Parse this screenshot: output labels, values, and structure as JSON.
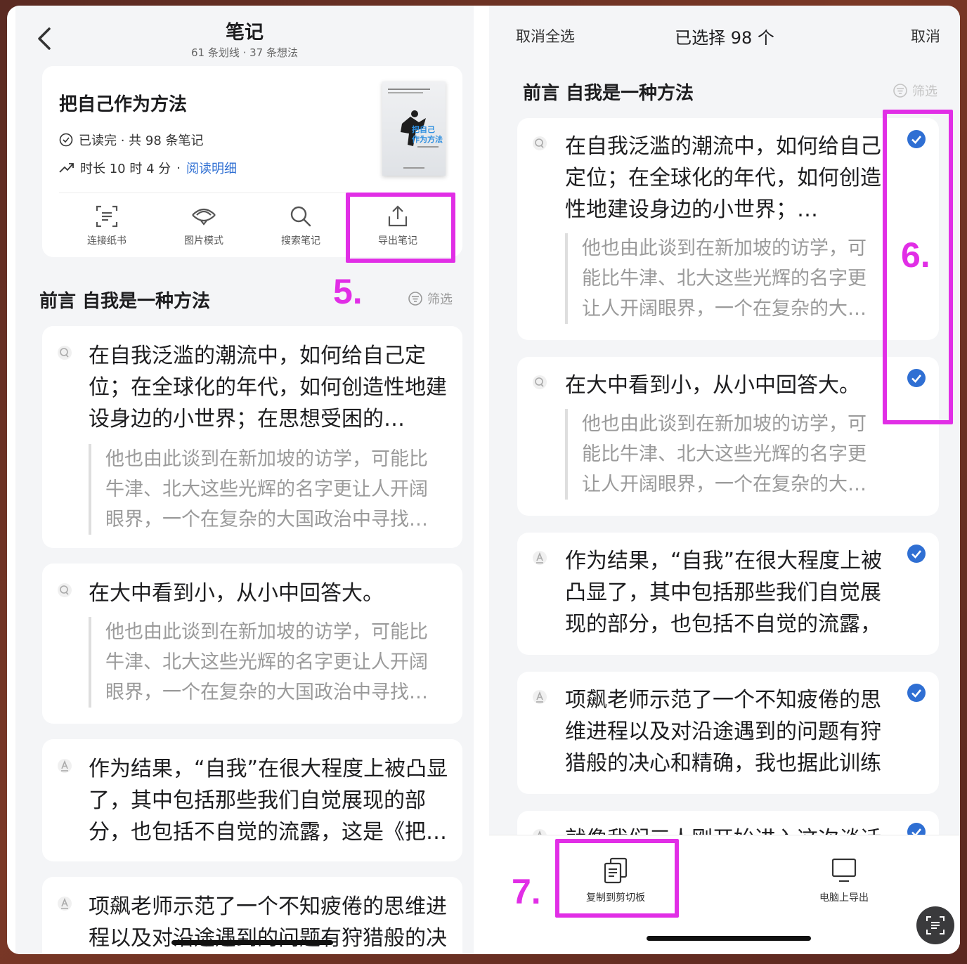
{
  "left": {
    "header": {
      "title": "笔记",
      "subtitle": "61 条划线 · 37 条想法"
    },
    "book": {
      "title": "把自己作为方法",
      "status": "已读完 · 共 98 条笔记",
      "duration": "时长 10 时 4 分",
      "sep": "·",
      "link": "阅读明细",
      "cover_title": "把自己作为方法"
    },
    "tools": [
      {
        "label": "连接纸书",
        "icon": "scan-icon"
      },
      {
        "label": "图片模式",
        "icon": "image-mode-icon"
      },
      {
        "label": "搜索笔记",
        "icon": "search-icon"
      },
      {
        "label": "导出笔记",
        "icon": "export-icon"
      }
    ],
    "section": {
      "title": "前言 自我是一种方法",
      "filter": "筛选"
    },
    "notes": [
      {
        "type": "thought",
        "text": "在自我泛滥的潮流中，如何给自己定位；在全球化的年代，如何创造性地建设身边的小世界；在思想受困的…",
        "quote": "他也由此谈到在新加坡的访学，可能比牛津、北大这些光辉的名字更让人开阔眼界，一个在复杂的大国政治中寻找…"
      },
      {
        "type": "thought",
        "text": "在大中看到小，从小中回答大。",
        "quote": "他也由此谈到在新加坡的访学，可能比牛津、北大这些光辉的名字更让人开阔眼界，一个在复杂的大国政治中寻找…"
      },
      {
        "type": "highlight",
        "text": "作为结果，“自我”在很大程度上被凸显了，其中包括那些我们自觉展现的部分，也包括不自觉的流露，这是《把…"
      },
      {
        "type": "highlight",
        "text": "项飙老师示范了一个不知疲倦的思维进程以及对沿途遇到的问题有狩猎般的决"
      }
    ]
  },
  "right": {
    "header": {
      "deselect_all": "取消全选",
      "selected": "已选择 98 个",
      "cancel": "取消"
    },
    "section": {
      "title": "前言 自我是一种方法",
      "filter": "筛选"
    },
    "notes": [
      {
        "type": "thought",
        "text": "在自我泛滥的潮流中，如何给自己定位；在全球化的年代，如何创造性地建设身边的小世界；…",
        "quote": "他也由此谈到在新加坡的访学，可能比牛津、北大这些光辉的名字更让人开阔眼界，一个在复杂的大…",
        "checked": true
      },
      {
        "type": "thought",
        "text": "在大中看到小，从小中回答大。",
        "quote": "他也由此谈到在新加坡的访学，可能比牛津、北大这些光辉的名字更让人开阔眼界，一个在复杂的大…",
        "checked": true
      },
      {
        "type": "highlight",
        "text": "作为结果，“自我”在很大程度上被凸显了，其中包括那些我们自觉展现的部分，也包括不自觉的流露，这…",
        "checked": true
      },
      {
        "type": "highlight",
        "text": "项飙老师示范了一个不知疲倦的思维进程以及对沿途遇到的问题有狩猎般的决心和精确，我也据此训练自己…",
        "checked": true
      },
      {
        "type": "highlight",
        "text": "就像我们三人刚开始进入这次谈话",
        "checked": true
      }
    ],
    "bottom": {
      "copy": "复制到剪切板",
      "pc_export": "电脑上导出"
    }
  },
  "annotations": {
    "step5": "5.",
    "step6": "6.",
    "step7": "7."
  },
  "colors": {
    "accent": "#2f6fd3",
    "check": "#2f6fd3",
    "annotation": "#e12ee6"
  }
}
